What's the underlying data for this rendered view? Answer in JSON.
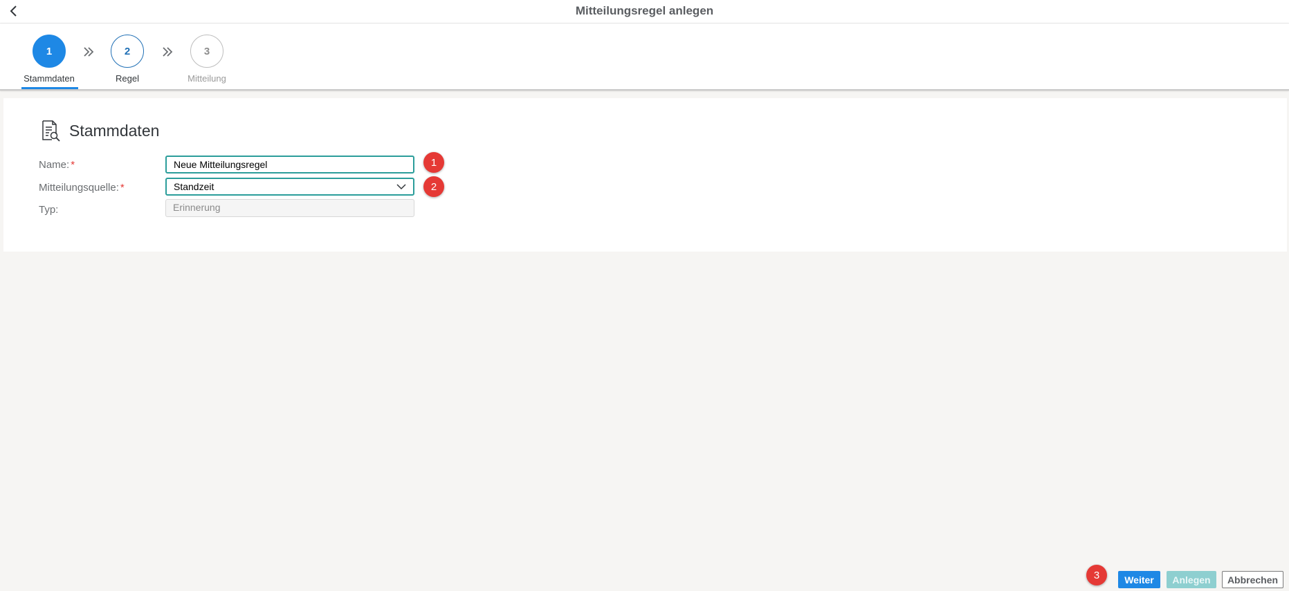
{
  "header": {
    "title": "Mitteilungsregel anlegen",
    "back_icon": "chevron-left-icon"
  },
  "wizard": {
    "steps": [
      {
        "number": "1",
        "label": "Stammdaten",
        "state": "active"
      },
      {
        "number": "2",
        "label": "Regel",
        "state": "available"
      },
      {
        "number": "3",
        "label": "Mitteilung",
        "state": "disabled"
      }
    ],
    "separator_icon": "double-chevron-right-icon"
  },
  "section": {
    "title": "Stammdaten",
    "icon": "document-search-icon"
  },
  "form": {
    "name_label": "Name:",
    "name_required": "*",
    "name_value": "Neue Mitteilungsregel",
    "source_label": "Mitteilungsquelle:",
    "source_required": "*",
    "source_value": "Standzeit",
    "type_label": "Typ:",
    "type_value": "Erinnerung"
  },
  "annotations": [
    "1",
    "2",
    "3"
  ],
  "footer": {
    "weiter_label": "Weiter",
    "anlegen_label": "Anlegen",
    "abbrechen_label": "Abbrechen"
  },
  "colors": {
    "accent": "#1e88e5",
    "focus_border": "#2a9d9a",
    "badge": "#e53935",
    "disabled_button": "#8ecfd0"
  }
}
